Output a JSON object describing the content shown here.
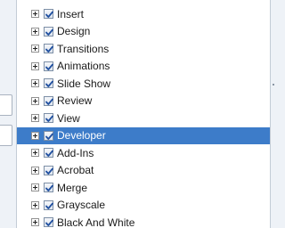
{
  "tabs_list": {
    "items": [
      {
        "label": "Insert",
        "checked": true,
        "selected": false
      },
      {
        "label": "Design",
        "checked": true,
        "selected": false
      },
      {
        "label": "Transitions",
        "checked": true,
        "selected": false
      },
      {
        "label": "Animations",
        "checked": true,
        "selected": false
      },
      {
        "label": "Slide Show",
        "checked": true,
        "selected": false
      },
      {
        "label": "Review",
        "checked": true,
        "selected": false
      },
      {
        "label": "View",
        "checked": true,
        "selected": false
      },
      {
        "label": "Developer",
        "checked": true,
        "selected": true
      },
      {
        "label": "Add-Ins",
        "checked": true,
        "selected": false
      },
      {
        "label": "Acrobat",
        "checked": true,
        "selected": false
      },
      {
        "label": "Merge",
        "checked": true,
        "selected": false
      },
      {
        "label": "Grayscale",
        "checked": true,
        "selected": false
      },
      {
        "label": "Black And White",
        "checked": true,
        "selected": false
      }
    ]
  },
  "colors": {
    "selection": "#3d7cc9",
    "checkmark": "#1f4fa0",
    "panel_border": "#c3ccd6",
    "background": "#eef2f7"
  },
  "icons": {
    "expander": "plus-box-icon",
    "check": "checkmark-icon"
  }
}
